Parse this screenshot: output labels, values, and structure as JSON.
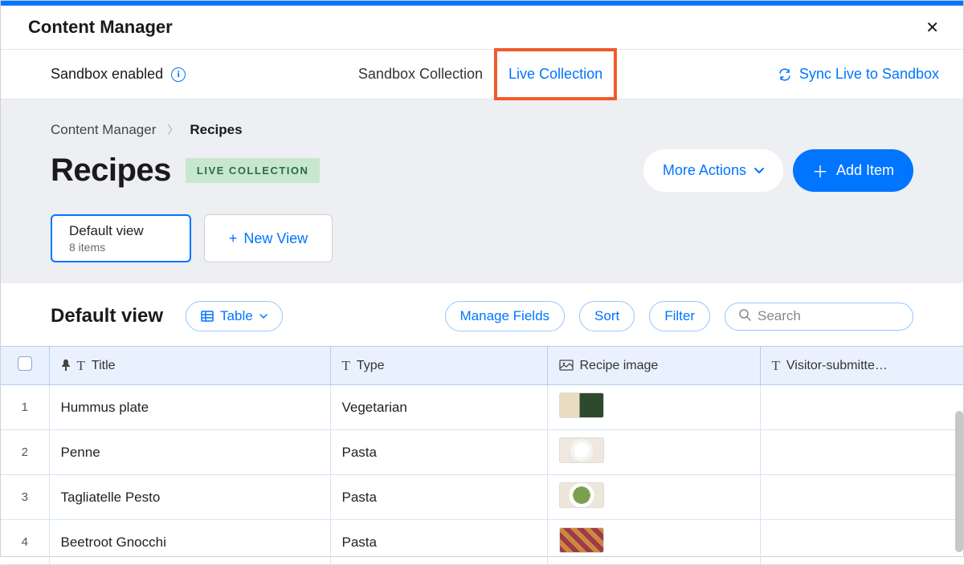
{
  "header": {
    "title": "Content Manager"
  },
  "subbar": {
    "sandbox_label": "Sandbox enabled",
    "tab_sandbox": "Sandbox Collection",
    "tab_live": "Live Collection",
    "sync_label": "Sync Live to Sandbox"
  },
  "breadcrumb": {
    "root": "Content Manager",
    "current": "Recipes"
  },
  "page": {
    "title": "Recipes",
    "badge": "LIVE COLLECTION",
    "more_actions": "More Actions",
    "add_item": "Add Item"
  },
  "views": {
    "default_name": "Default view",
    "default_count": "8 items",
    "new_view": "New View"
  },
  "toolbar": {
    "view_name": "Default view",
    "table_label": "Table",
    "manage_fields": "Manage Fields",
    "sort": "Sort",
    "filter": "Filter",
    "search_placeholder": "Search"
  },
  "columns": {
    "title": "Title",
    "type": "Type",
    "image": "Recipe image",
    "visitor": "Visitor-submitte…"
  },
  "rows": [
    {
      "n": "1",
      "title": "Hummus plate",
      "type": "Vegetarian"
    },
    {
      "n": "2",
      "title": "Penne",
      "type": "Pasta"
    },
    {
      "n": "3",
      "title": "Tagliatelle Pesto",
      "type": "Pasta"
    },
    {
      "n": "4",
      "title": "Beetroot Gnocchi",
      "type": "Pasta"
    }
  ]
}
